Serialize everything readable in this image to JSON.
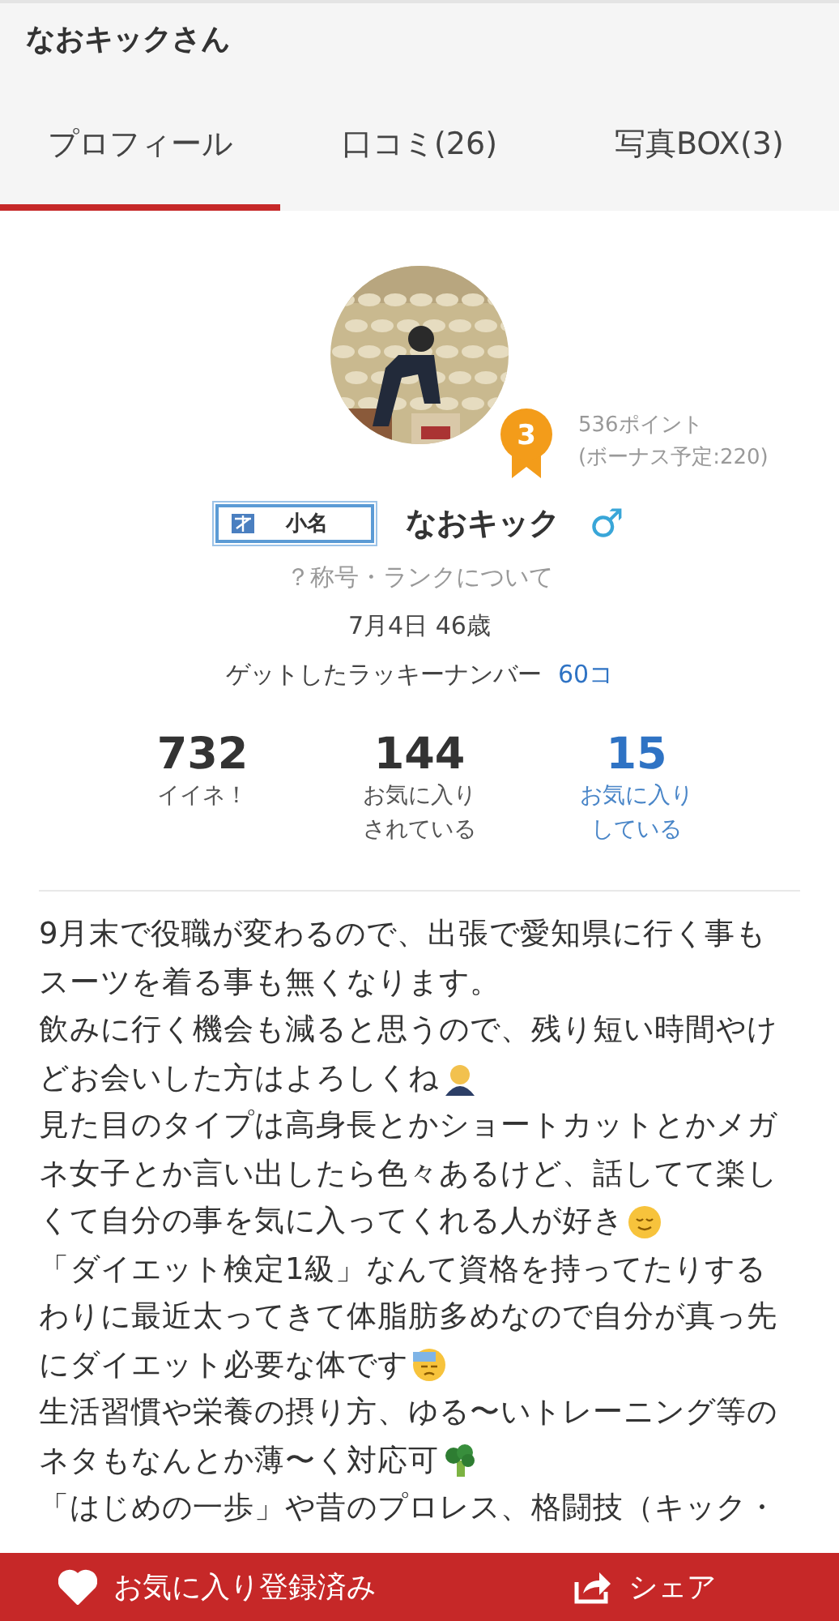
{
  "header": {
    "title": "なおキックさん"
  },
  "tabs": [
    {
      "label": "プロフィール",
      "selected": true
    },
    {
      "label": "口コミ(26)",
      "selected": false
    },
    {
      "label": "写真BOX(3)",
      "selected": false
    }
  ],
  "profile": {
    "rank": "3",
    "points": "536ポイント",
    "bonus": "(ボーナス予定:220)",
    "title_badge": "小名",
    "name": "なおキック",
    "gender_symbol": "♂",
    "rank_help": "？称号・ランクについて",
    "birthday": "7月4日 46歳",
    "lucky_label": "ゲットしたラッキーナンバー",
    "lucky_count": "60コ"
  },
  "stats": [
    {
      "value": "732",
      "label": [
        "イイネ！"
      ],
      "link": false
    },
    {
      "value": "144",
      "label": [
        "お気に入り",
        "されている"
      ],
      "link": false
    },
    {
      "value": "15",
      "label": [
        "お気に入り",
        "している"
      ],
      "link": true
    }
  ],
  "bio": [
    {
      "text": "9月末で役職が変わるので、出張で愛知県に行く事も",
      "kind": "plain"
    },
    {
      "text": "スーツを着る事も無くなります。",
      "kind": "plain"
    },
    {
      "text": "飲みに行く機会も減ると思うので、残り短い時間やけ",
      "kind": "plain"
    },
    {
      "text": "どお会いした方はよろしくね",
      "kind": "bow"
    },
    {
      "text": "見た目のタイプは高身長とかショートカットとかメガ",
      "kind": "plain"
    },
    {
      "text": "ネ女子とか言い出したら色々あるけど、話してて楽し",
      "kind": "plain"
    },
    {
      "text": "くて自分の事を気に入ってくれる人が好き",
      "kind": "smile"
    },
    {
      "text": "「ダイエット検定1級」なんて資格を持ってたりする",
      "kind": "plain"
    },
    {
      "text": "わりに最近太ってきて体脂肪多めなので自分が真っ先",
      "kind": "plain"
    },
    {
      "text": "にダイエット必要な体です",
      "kind": "sweat"
    },
    {
      "text": "生活習慣や栄養の摂り方、ゆる〜いトレーニング等の",
      "kind": "plain"
    },
    {
      "text": "ネタもなんとか薄〜く対応可",
      "kind": "broccoli"
    },
    {
      "text": "「はじめの一歩」や昔のプロレス、格闘技（キック・",
      "kind": "plain"
    }
  ],
  "bottom_bar": {
    "favorite": {
      "label": "お気に入り登録済み",
      "on": true
    },
    "share": {
      "label": "シェア"
    }
  }
}
